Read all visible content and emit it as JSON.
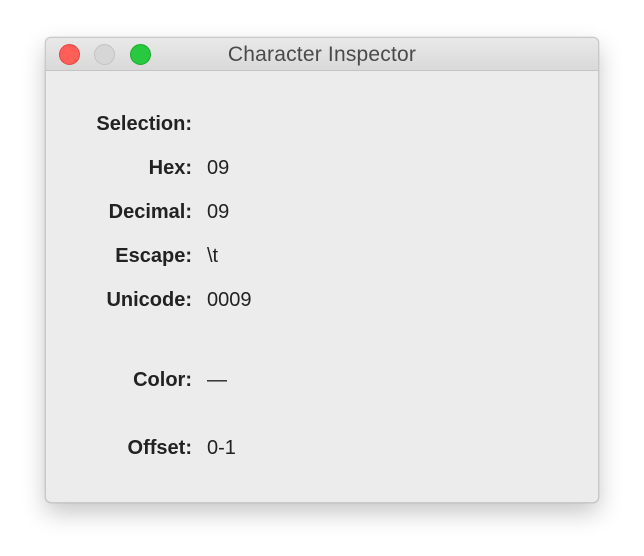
{
  "window": {
    "title": "Character Inspector"
  },
  "inspector": {
    "selection_label": "Selection:",
    "hex_label": "Hex:",
    "hex_value": "09",
    "decimal_label": "Decimal:",
    "decimal_value": "09",
    "escape_label": "Escape:",
    "escape_value": "\\t",
    "unicode_label": "Unicode:",
    "unicode_value": "0009",
    "color_label": "Color:",
    "color_value": "—",
    "offset_label": "Offset:",
    "offset_value": "0-1"
  },
  "colors": {
    "close": "#ff5f57",
    "minimize": "#d6d6d6",
    "zoom": "#28c840",
    "window_bg": "#ececec"
  }
}
